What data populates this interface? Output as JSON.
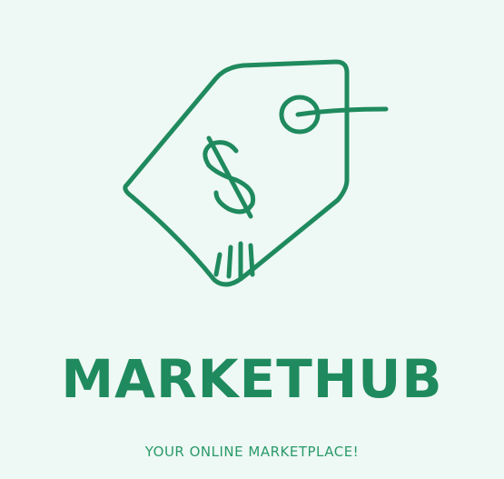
{
  "brand": {
    "name": "MARKETHUB",
    "tagline": "YOUR ONLINE MARKETPLACE!",
    "primary_color": "#1f8a5e",
    "background_color": "#eef8f4"
  },
  "icon": {
    "name": "price-tag-icon",
    "symbol": "$"
  }
}
